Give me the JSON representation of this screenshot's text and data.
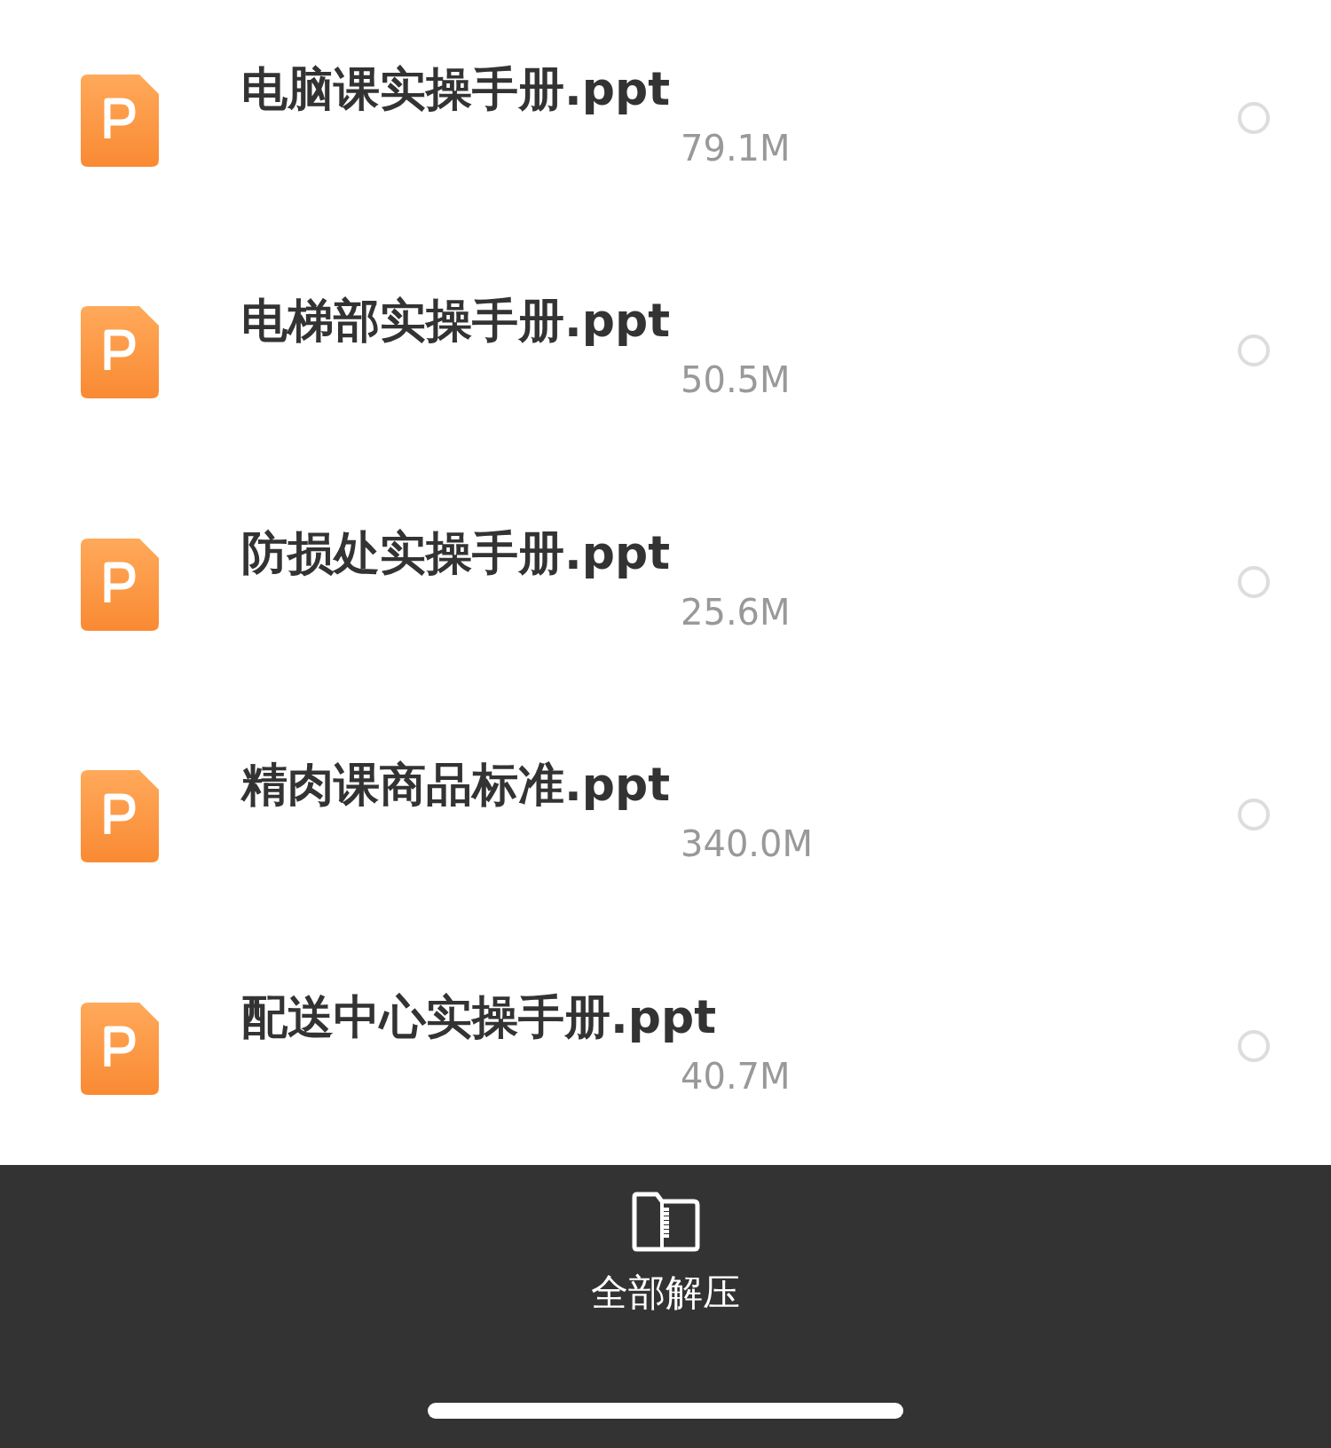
{
  "files": [
    {
      "name": "电脑课实操手册.ppt",
      "size": "79.1M",
      "selected": false
    },
    {
      "name": "电梯部实操手册.ppt",
      "size": "50.5M",
      "selected": false
    },
    {
      "name": "防损处实操手册.ppt",
      "size": "25.6M",
      "selected": false
    },
    {
      "name": "精肉课商品标准.ppt",
      "size": "340.0M",
      "selected": false
    },
    {
      "name": "配送中心实操手册.ppt",
      "size": "40.7M",
      "selected": false
    }
  ],
  "bottom_bar": {
    "action": "全部解压"
  }
}
